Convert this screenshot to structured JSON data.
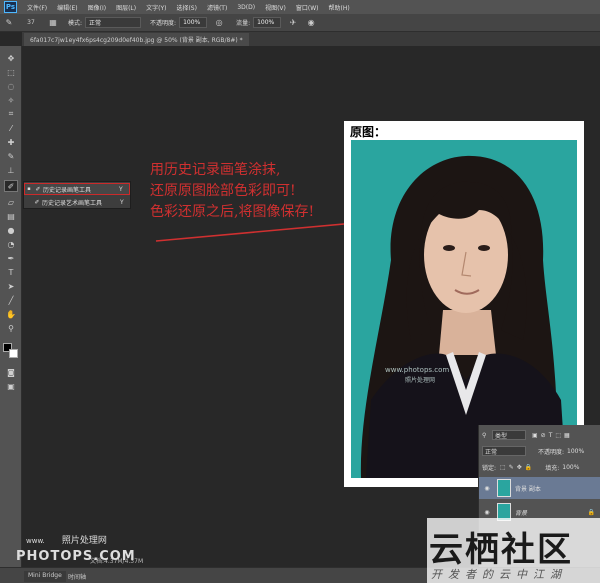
{
  "menubar": {
    "logo": "Ps",
    "items": [
      "文件(F)",
      "编辑(E)",
      "图像(I)",
      "图层(L)",
      "文字(Y)",
      "选择(S)",
      "滤镜(T)",
      "3D(D)",
      "视图(V)",
      "窗口(W)",
      "帮助(H)"
    ]
  },
  "options": {
    "brush_size": "37",
    "mode_label": "模式:",
    "mode_value": "正常",
    "opacity_label": "不透明度:",
    "opacity_value": "100%",
    "flow_label": "流量:",
    "flow_value": "100%"
  },
  "document_tab": "6fa017c7jw1ey4fx6ps4cg209d0ef40b.jpg @ 50% (背景 副本, RGB/8#) *",
  "flyout": {
    "items": [
      {
        "label": "历史记录画笔工具",
        "shortcut": "Y"
      },
      {
        "label": "历史记录艺术画笔工具",
        "shortcut": "Y"
      }
    ]
  },
  "annotation": {
    "lines": [
      "用历史记录画笔涂抹,",
      "还原原图脸部色彩即可!",
      "色彩还原之后,将图像保存!"
    ],
    "color": "#d03030"
  },
  "photo": {
    "title": "原图：",
    "background_color": "#2aa59f",
    "inner_watermark": "www.photops.com",
    "inner_watermark_cn": "照片处理网"
  },
  "layers": {
    "filter_label": "类型",
    "blend_mode": "正常",
    "opacity_label": "不透明度:",
    "opacity_value": "100%",
    "lock_label": "锁定:",
    "fill_label": "填充:",
    "fill_value": "100%",
    "items": [
      {
        "name": "背景 副本"
      },
      {
        "name": "背景"
      }
    ]
  },
  "status": {
    "doc_info": "文档:4.37M/4.37M",
    "tabs": [
      "Mini Bridge",
      "时间轴"
    ]
  },
  "watermarks": {
    "left_site": "www.",
    "left_cn": "照片处理网",
    "left_brand": "PHOTOPS.COM",
    "right_brand": "云栖社区",
    "right_sub": "开发者的云中江湖"
  }
}
